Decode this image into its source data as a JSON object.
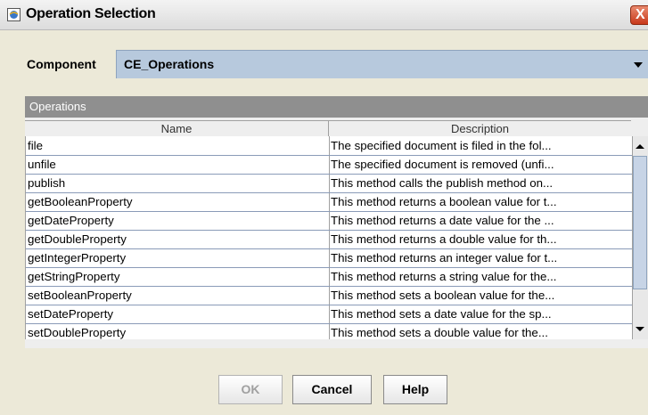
{
  "window": {
    "title": "Operation Selection",
    "close_glyph": "X"
  },
  "component": {
    "label": "Component",
    "value": "CE_Operations"
  },
  "operations": {
    "panel_title": "Operations",
    "columns": [
      "Name",
      "Description"
    ],
    "rows": [
      {
        "name": "file",
        "description": "The specified document is filed in the fol..."
      },
      {
        "name": "unfile",
        "description": "The specified document is removed (unfi..."
      },
      {
        "name": "publish",
        "description": "This method calls the publish method on..."
      },
      {
        "name": "getBooleanProperty",
        "description": "This method returns a boolean value for t..."
      },
      {
        "name": "getDateProperty",
        "description": "This method returns a date value for the ..."
      },
      {
        "name": "getDoubleProperty",
        "description": "This method returns a double value for th..."
      },
      {
        "name": "getIntegerProperty",
        "description": "This method returns an integer value for t..."
      },
      {
        "name": "getStringProperty",
        "description": "This method returns a string value for the..."
      },
      {
        "name": "setBooleanProperty",
        "description": "This method sets a boolean value for the..."
      },
      {
        "name": "setDateProperty",
        "description": "This method sets a date value for the sp..."
      },
      {
        "name": "setDoubleProperty",
        "description": "This method sets a double value for the..."
      }
    ]
  },
  "buttons": {
    "ok": "OK",
    "cancel": "Cancel",
    "help": "Help"
  }
}
